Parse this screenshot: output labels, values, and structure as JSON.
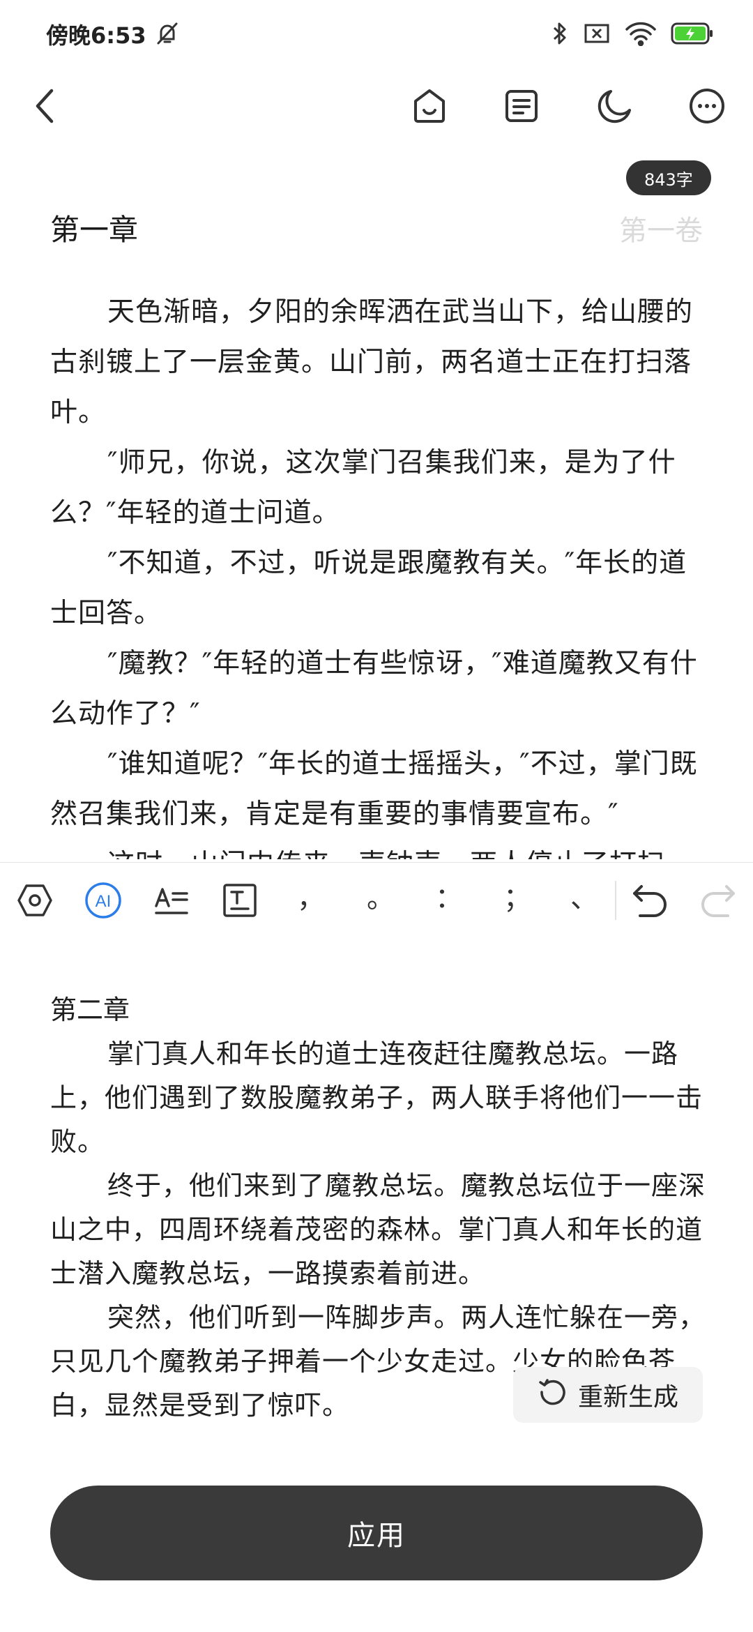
{
  "status_bar": {
    "time": "傍晚6:53",
    "icons": [
      "bell-off-icon",
      "bluetooth-icon",
      "sim-none-icon",
      "wifi-icon",
      "battery-charging-icon"
    ],
    "battery_color": "#4cd137"
  },
  "toolbar": {
    "icons": [
      "back-icon",
      "assistant-icon",
      "outline-icon",
      "night-mode-icon",
      "more-icon"
    ]
  },
  "editor": {
    "word_count": "843字",
    "chapter_title": "第一章",
    "volume_title": "第一卷",
    "paragraphs": [
      "天色渐暗，夕阳的余晖洒在武当山下，给山腰的古刹镀上了一层金黄。山门前，两名道士正在打扫落叶。",
      "″师兄，你说，这次掌门召集我们来，是为了什么？″年轻的道士问道。",
      "″不知道，不过，听说是跟魔教有关。″年长的道士回答。",
      "″魔教？″年轻的道士有些惊讶，″难道魔教又有什么动作了？″",
      "″谁知道呢？″年长的道士摇摇头，″不过，掌门既然召集我们来，肯定是有重要的事情要宣布。″",
      "这时，山门内传来一声钟声，两人停止了打扫"
    ]
  },
  "format_toolbar": {
    "icons": [
      "hexagon-icon",
      "ai-icon",
      "text-format-icon",
      "text-box-icon",
      "undo-icon",
      "redo-icon"
    ],
    "punctuation": [
      "，",
      "。",
      "：",
      "；",
      "、"
    ],
    "ai_color": "#2b7de9"
  },
  "generated": {
    "chapter_title": "第二章",
    "paragraphs": [
      "掌门真人和年长的道士连夜赶往魔教总坛。一路上，他们遇到了数股魔教弟子，两人联手将他们一一击败。",
      "终于，他们来到了魔教总坛。魔教总坛位于一座深山之中，四周环绕着茂密的森林。掌门真人和年长的道士潜入魔教总坛，一路摸索着前进。",
      "突然，他们听到一阵脚步声。两人连忙躲在一旁，只见几个魔教弟子押着一个少女走过。少女的脸色苍白，显然是受到了惊吓。"
    ],
    "regenerate_label": "重新生成"
  },
  "apply_label": "应用"
}
